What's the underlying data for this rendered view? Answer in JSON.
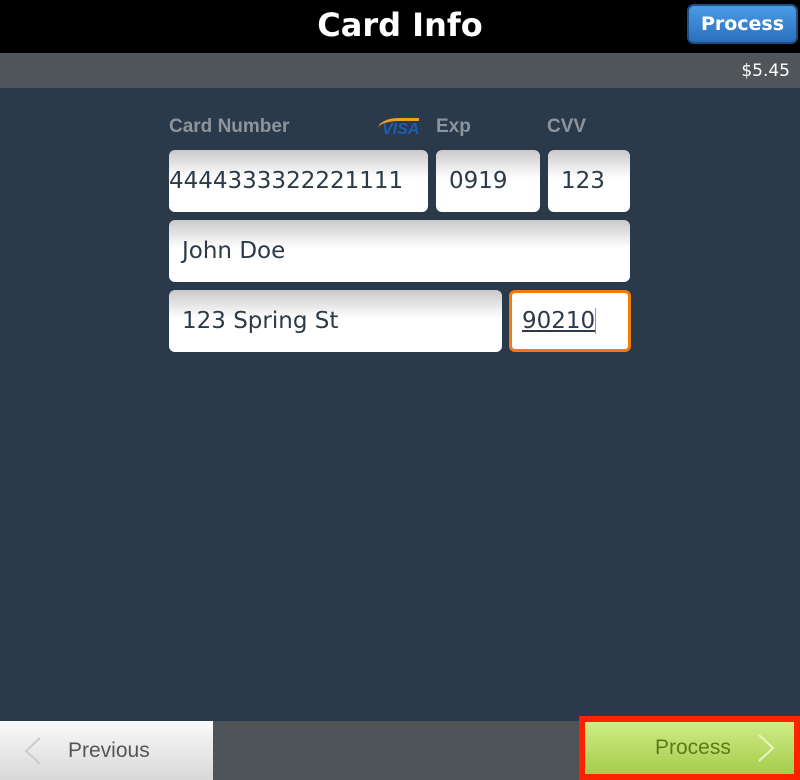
{
  "header": {
    "title": "Card Info",
    "process_label": "Process"
  },
  "amount": "$5.45",
  "form": {
    "card_number_label": "Card Number",
    "card_brand": "VISA",
    "exp_label": "Exp",
    "cvv_label": "CVV",
    "card_number": "4444333322221111",
    "exp": "0919",
    "cvv": "123",
    "name": "John Doe",
    "street": "123 Spring St",
    "zip": "90210"
  },
  "footer": {
    "previous_label": "Previous",
    "process_label": "Process"
  },
  "colors": {
    "accent": "#f57a0c",
    "highlight": "#ff2200",
    "process_green": "#b8dc62",
    "header_blue": "#3a86d6"
  }
}
